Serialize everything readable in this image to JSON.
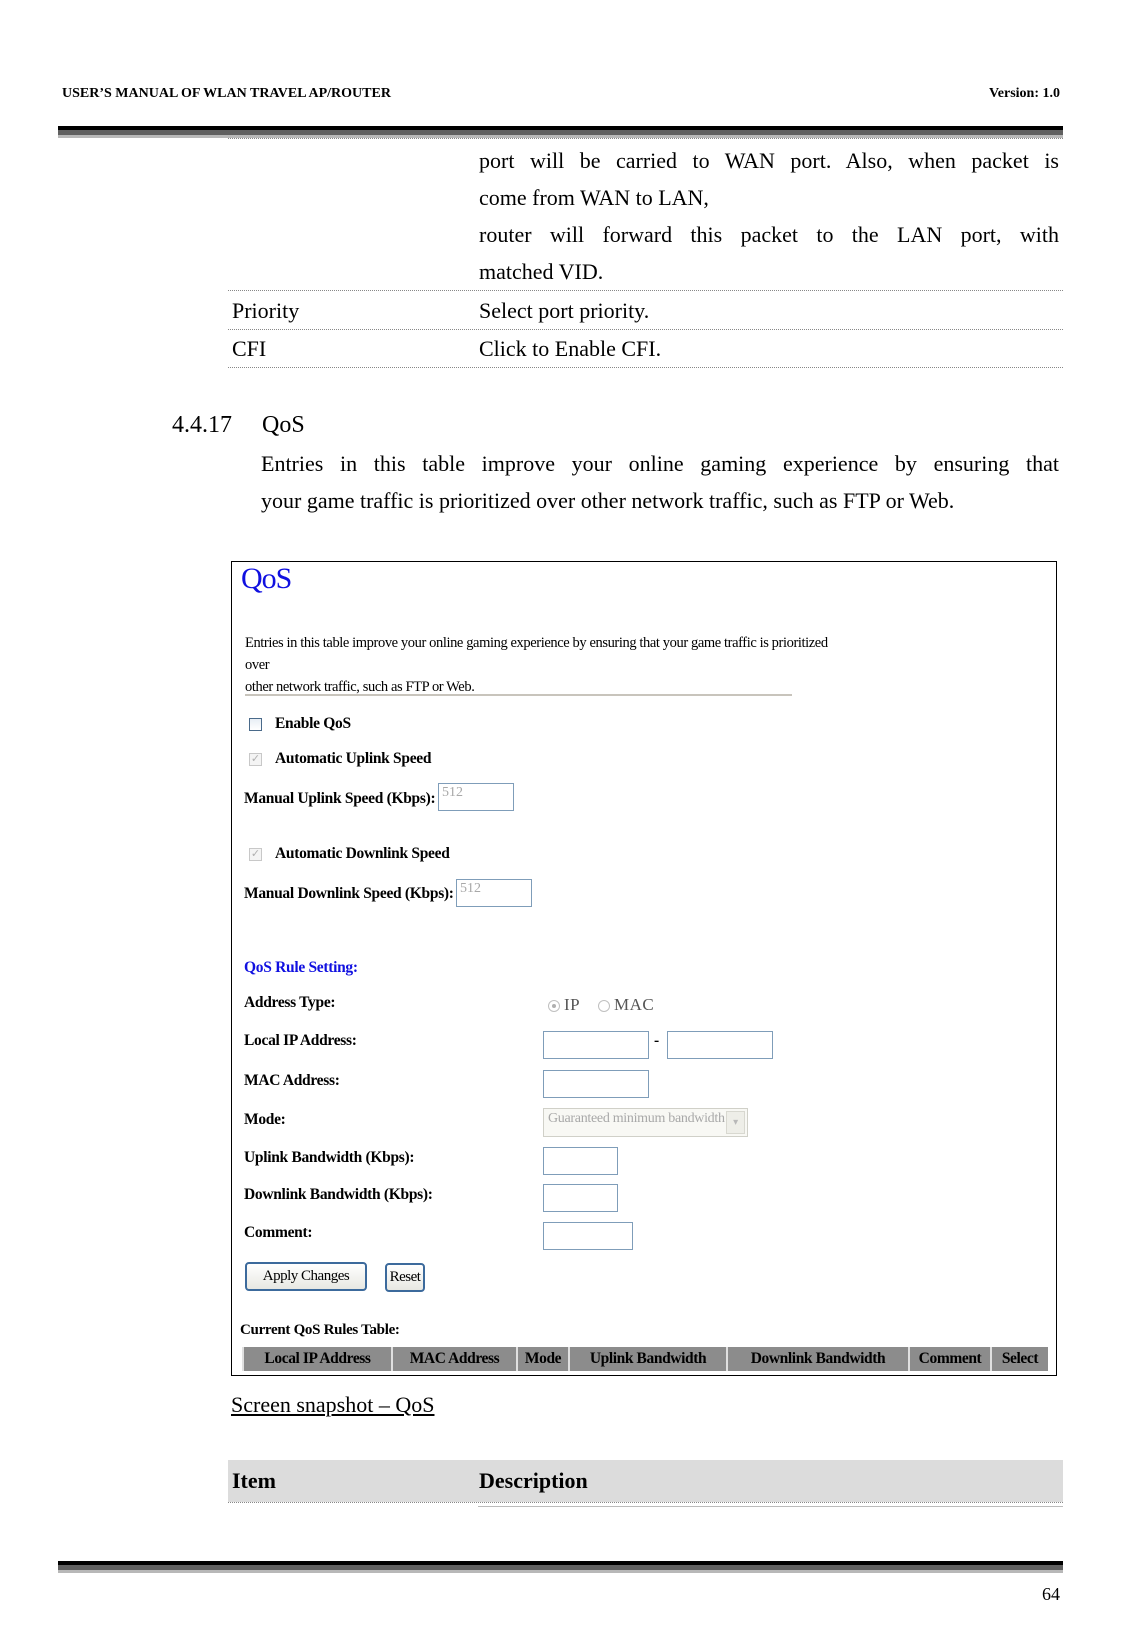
{
  "header": {
    "title": "USER’S MANUAL OF WLAN TRAVEL AP/ROUTER",
    "version": "Version: 1.0"
  },
  "prev_table": {
    "continued_lines": [
      "port will be carried to WAN port. Also, when packet is",
      "come from WAN to LAN,",
      "router will forward this packet to the LAN port, with",
      "matched VID."
    ],
    "rows": [
      {
        "item": "Priority",
        "description": "Select port priority."
      },
      {
        "item": "CFI",
        "description": "Click to Enable CFI."
      }
    ]
  },
  "section": {
    "number": "4.4.17",
    "title": "QoS",
    "paragraph_lines": [
      "Entries in this table improve your online gaming experience by ensuring that",
      "your game traffic is prioritized over other network traffic, such as FTP or Web."
    ]
  },
  "screenshot": {
    "title": "QoS",
    "intro_lines": [
      "Entries in this table improve your online gaming experience by ensuring that your game traffic is prioritized over",
      "other network traffic, such as FTP or Web."
    ],
    "enable_qos": {
      "label": "Enable QoS",
      "checked": false
    },
    "auto_uplink": {
      "label": "Automatic Uplink Speed",
      "checked": true
    },
    "manual_uplink": {
      "label": "Manual Uplink Speed (Kbps):",
      "value": "512"
    },
    "auto_downlink": {
      "label": "Automatic Downlink Speed",
      "checked": true
    },
    "manual_downlink": {
      "label": "Manual Downlink Speed (Kbps):",
      "value": "512"
    },
    "rule_heading": "QoS Rule Setting:",
    "address_type": {
      "label": "Address Type:",
      "options": [
        "IP",
        "MAC"
      ],
      "selected": "IP"
    },
    "local_ip": {
      "label": "Local IP Address:",
      "from": "",
      "to": "",
      "separator": "-"
    },
    "mac_address": {
      "label": "MAC Address:",
      "value": ""
    },
    "mode": {
      "label": "Mode:",
      "selected": "Guaranteed minimum bandwidth"
    },
    "uplink_bw": {
      "label": "Uplink Bandwidth (Kbps):",
      "value": ""
    },
    "downlink_bw": {
      "label": "Downlink Bandwidth (Kbps):",
      "value": ""
    },
    "comment": {
      "label": "Comment:",
      "value": ""
    },
    "apply_button": "Apply Changes",
    "reset_button": "Reset",
    "rules_table_title": "Current QoS Rules Table:",
    "rules_table_columns": [
      "Local IP Address",
      "MAC Address",
      "Mode",
      "Uplink Bandwidth",
      "Downlink Bandwidth",
      "Comment",
      "Select"
    ]
  },
  "caption": "Screen snapshot – QoS",
  "desc_table": {
    "col_item": "Item",
    "col_description": "Description"
  },
  "footer": {
    "page_number": "64"
  },
  "icons": {
    "checked": "✓",
    "dropdown": "▾"
  }
}
